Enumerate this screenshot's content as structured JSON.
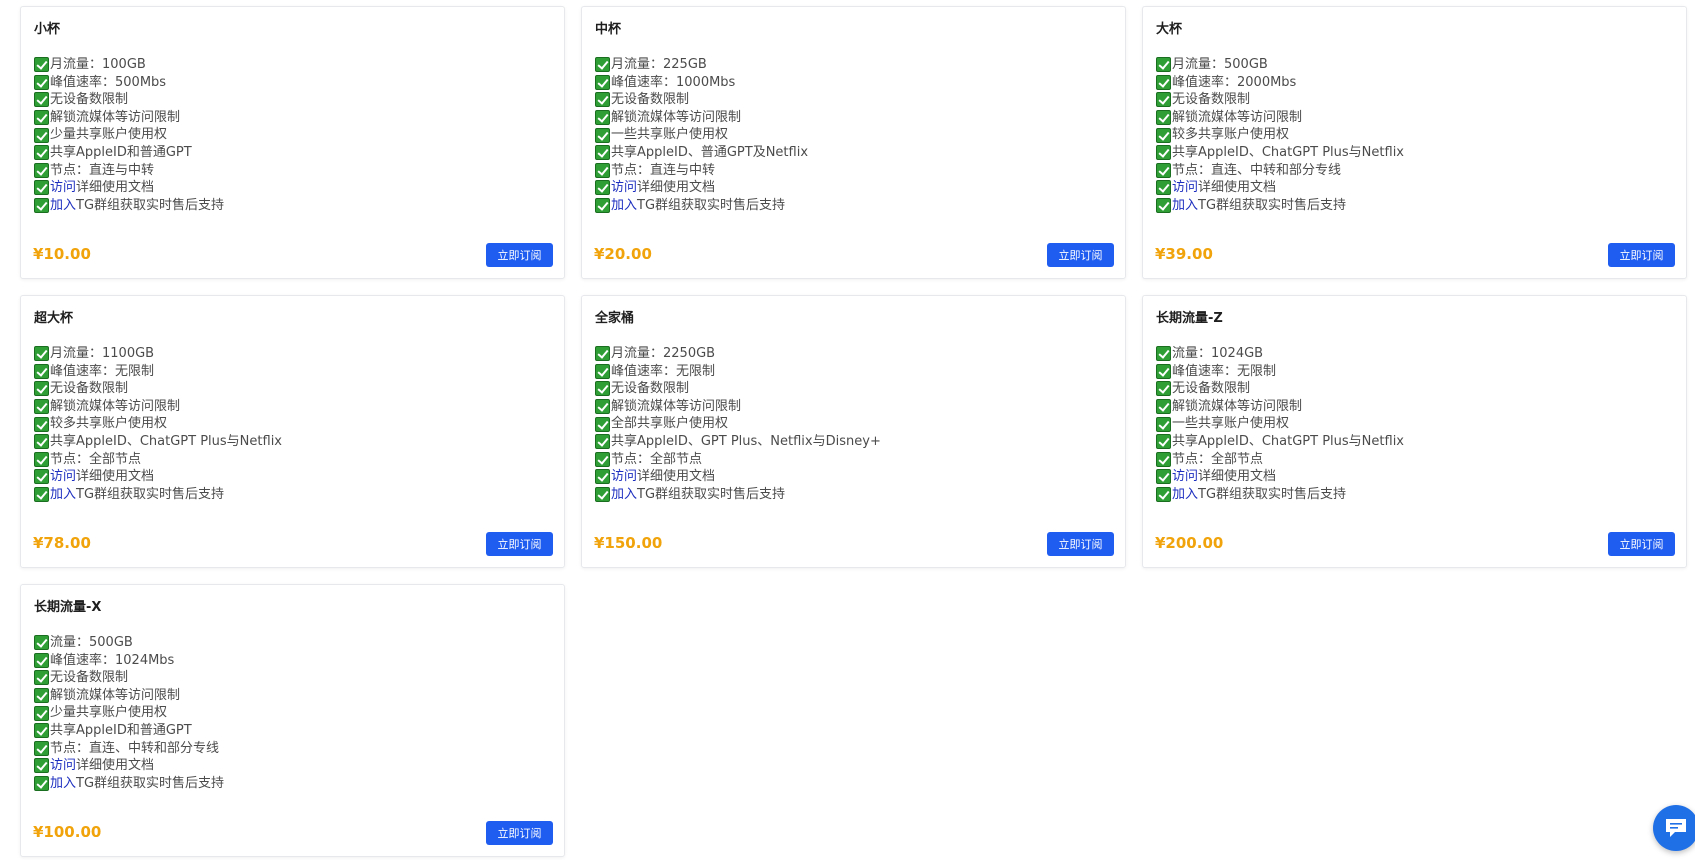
{
  "subscribe_label": "立即订阅",
  "plans": [
    {
      "name": "小杯",
      "price": "¥10.00",
      "features": [
        {
          "text": "月流量：100GB"
        },
        {
          "text": "峰值速率：500Mbs"
        },
        {
          "text": "无设备数限制"
        },
        {
          "text": "解锁流媒体等访问限制"
        },
        {
          "text": "少量共享账户使用权"
        },
        {
          "text": "共享AppleID和普通GPT"
        },
        {
          "text": "节点：直连与中转"
        },
        {
          "link": "访问",
          "text": "详细使用文档"
        },
        {
          "link": "加入",
          "text": "TG群组获取实时售后支持"
        }
      ]
    },
    {
      "name": "中杯",
      "price": "¥20.00",
      "features": [
        {
          "text": "月流量：225GB"
        },
        {
          "text": "峰值速率：1000Mbs"
        },
        {
          "text": "无设备数限制"
        },
        {
          "text": "解锁流媒体等访问限制"
        },
        {
          "text": "一些共享账户使用权"
        },
        {
          "text": "共享AppleID、普通GPT及Netflix"
        },
        {
          "text": "节点：直连与中转"
        },
        {
          "link": "访问",
          "text": "详细使用文档"
        },
        {
          "link": "加入",
          "text": "TG群组获取实时售后支持"
        }
      ]
    },
    {
      "name": "大杯",
      "price": "¥39.00",
      "features": [
        {
          "text": "月流量：500GB"
        },
        {
          "text": "峰值速率：2000Mbs"
        },
        {
          "text": "无设备数限制"
        },
        {
          "text": "解锁流媒体等访问限制"
        },
        {
          "text": "较多共享账户使用权"
        },
        {
          "text": "共享AppleID、ChatGPT Plus与Netflix"
        },
        {
          "text": "节点：直连、中转和部分专线"
        },
        {
          "link": "访问",
          "text": "详细使用文档"
        },
        {
          "link": "加入",
          "text": "TG群组获取实时售后支持"
        }
      ]
    },
    {
      "name": "超大杯",
      "price": "¥78.00",
      "features": [
        {
          "text": "月流量：1100GB"
        },
        {
          "text": "峰值速率：无限制"
        },
        {
          "text": "无设备数限制"
        },
        {
          "text": "解锁流媒体等访问限制"
        },
        {
          "text": "较多共享账户使用权"
        },
        {
          "text": "共享AppleID、ChatGPT Plus与Netflix"
        },
        {
          "text": "节点：全部节点"
        },
        {
          "link": "访问",
          "text": "详细使用文档"
        },
        {
          "link": "加入",
          "text": "TG群组获取实时售后支持"
        }
      ]
    },
    {
      "name": "全家桶",
      "price": "¥150.00",
      "features": [
        {
          "text": "月流量：2250GB"
        },
        {
          "text": "峰值速率：无限制"
        },
        {
          "text": "无设备数限制"
        },
        {
          "text": "解锁流媒体等访问限制"
        },
        {
          "text": "全部共享账户使用权"
        },
        {
          "text": "共享AppleID、GPT Plus、Netflix与Disney+"
        },
        {
          "text": "节点：全部节点"
        },
        {
          "link": "访问",
          "text": "详细使用文档"
        },
        {
          "link": "加入",
          "text": "TG群组获取实时售后支持"
        }
      ]
    },
    {
      "name": "长期流量-Z",
      "price": "¥200.00",
      "features": [
        {
          "text": "流量：1024GB"
        },
        {
          "text": "峰值速率：无限制"
        },
        {
          "text": "无设备数限制"
        },
        {
          "text": "解锁流媒体等访问限制"
        },
        {
          "text": "一些共享账户使用权"
        },
        {
          "text": "共享AppleID、ChatGPT Plus与Netflix"
        },
        {
          "text": "节点：全部节点"
        },
        {
          "link": "访问",
          "text": "详细使用文档"
        },
        {
          "link": "加入",
          "text": "TG群组获取实时售后支持"
        }
      ]
    },
    {
      "name": "长期流量-X",
      "price": "¥100.00",
      "features": [
        {
          "text": "流量：500GB"
        },
        {
          "text": "峰值速率：1024Mbs"
        },
        {
          "text": "无设备数限制"
        },
        {
          "text": "解锁流媒体等访问限制"
        },
        {
          "text": "少量共享账户使用权"
        },
        {
          "text": "共享AppleID和普通GPT"
        },
        {
          "text": "节点：直连、中转和部分专线"
        },
        {
          "link": "访问",
          "text": "详细使用文档"
        },
        {
          "link": "加入",
          "text": "TG群组获取实时售后支持"
        }
      ]
    }
  ],
  "icons": {
    "feature": "check-box-icon",
    "chat": "chat-bubble-icon"
  },
  "colors": {
    "price": "#f0a30a",
    "button": "#1f5cf0",
    "check": "#2e9e35",
    "link": "#1d2fbf",
    "chat": "#1f6fe6"
  }
}
